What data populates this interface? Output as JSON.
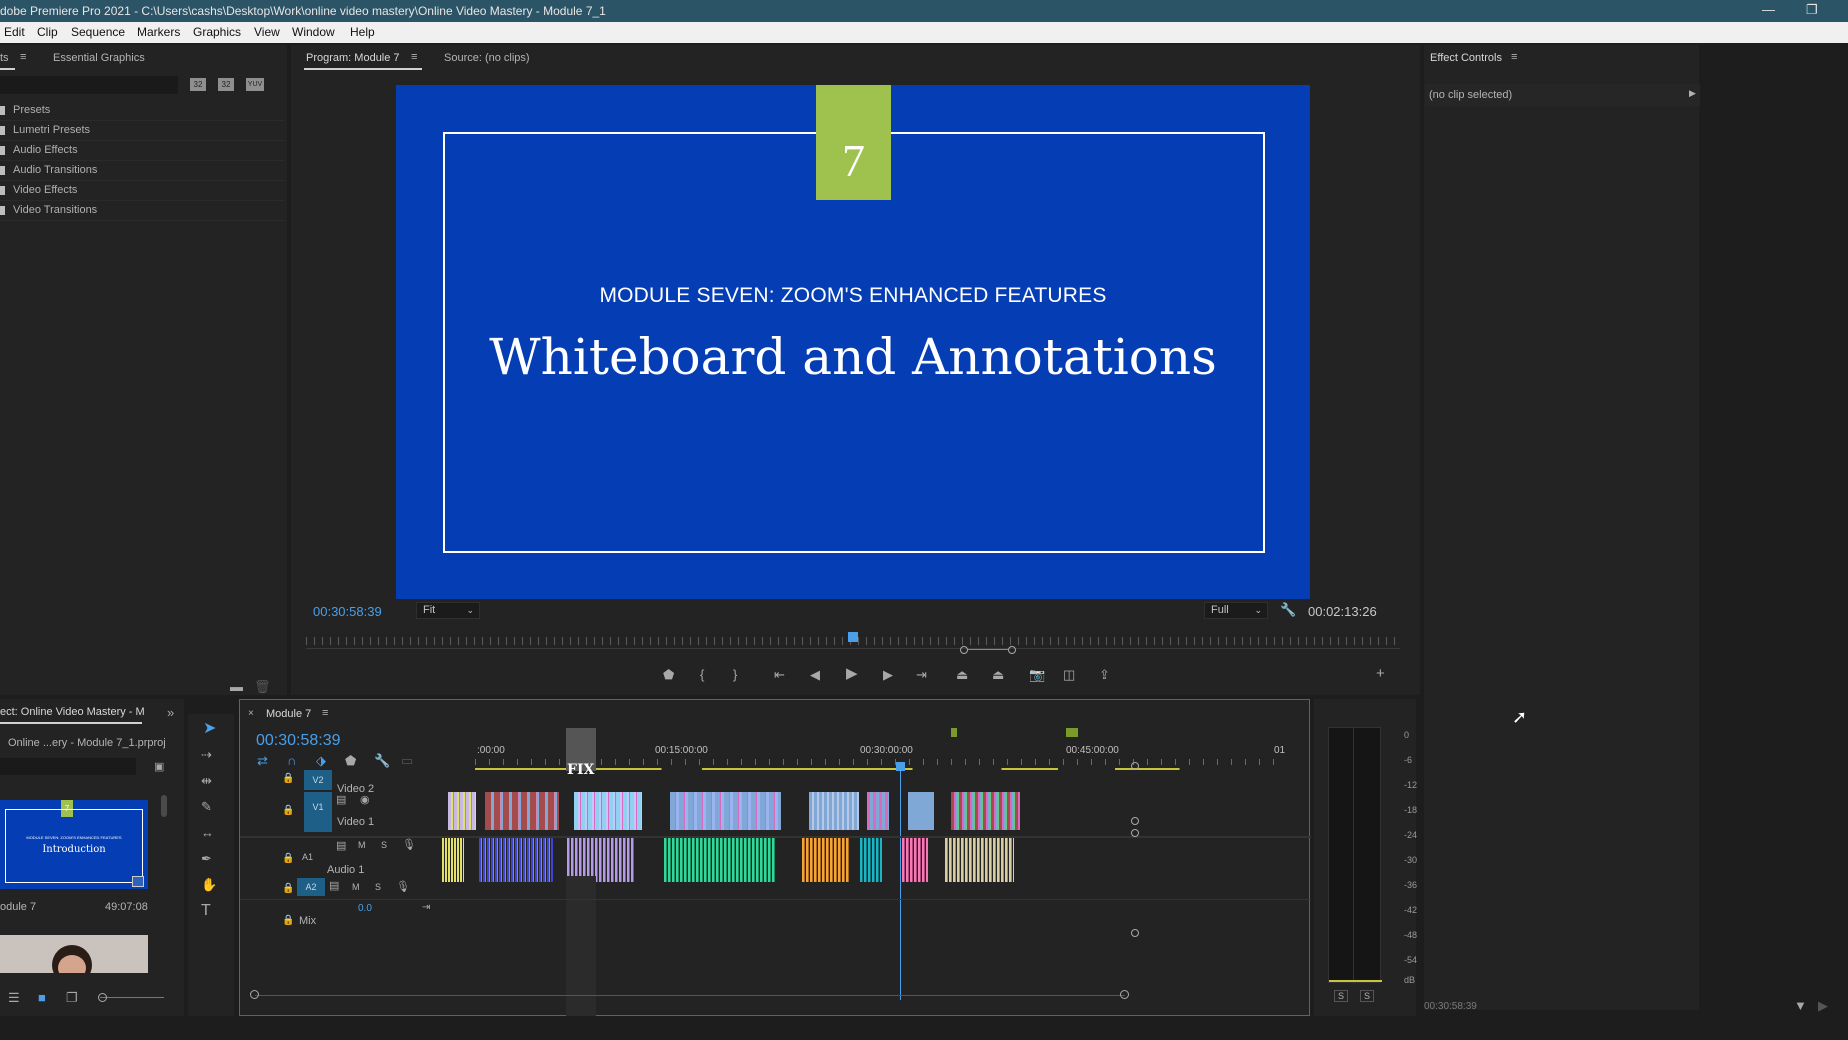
{
  "window": {
    "title": "dobe Premiere Pro 2021 - C:\\Users\\cashs\\Desktop\\Work\\online video mastery\\Online Video Mastery - Module 7_1",
    "minimize": "—",
    "restore": "❐"
  },
  "menu": [
    "Edit",
    "Clip",
    "Sequence",
    "Markers",
    "Graphics",
    "View",
    "Window",
    "Help"
  ],
  "effects_panel": {
    "tab_partial": "ts",
    "tab_essential": "Essential Graphics",
    "folders": [
      "Presets",
      "Lumetri Presets",
      "Audio Effects",
      "Audio Transitions",
      "Video Effects",
      "Video Transitions"
    ],
    "filter_icons": [
      "32",
      "32",
      "YUV"
    ]
  },
  "project_panel": {
    "tab": "ect: Online Video Mastery - M",
    "file": "Online ...ery - Module 7_1.prproj",
    "thumb1": {
      "sub": "MODULE SEVEN: ZOOM'S ENHANCED FEATURES",
      "title": "Introduction",
      "badge": "7"
    },
    "item_name": "odule 7",
    "item_duration": "49:07:08"
  },
  "program_monitor": {
    "tab_program": "Program: Module 7",
    "tab_source": "Source: (no clips)",
    "badge_number": "7",
    "subtitle": "MODULE SEVEN: ZOOM'S ENHANCED FEATURES",
    "title": "Whiteboard and Annotations",
    "timecode": "00:30:58:39",
    "fit": "Fit",
    "resolution": "Full",
    "duration": "00:02:13:26",
    "playhead_fraction": 0.5
  },
  "effect_controls": {
    "tab": "Effect Controls",
    "no_clip": "(no clip selected)",
    "timecode": "00:30:58:39"
  },
  "timeline": {
    "sequence_name": "Module 7",
    "timecode": "00:30:58:39",
    "ruler": [
      ":00:00",
      "00:15:00:00",
      "00:30:00:00",
      "00:45:00:00",
      "01"
    ],
    "fix_label": "FIX",
    "tracks": {
      "v2": {
        "tag": "V2",
        "name": "Video 2"
      },
      "v1": {
        "tag": "V1",
        "name": "Video 1"
      },
      "a1": {
        "tag": "A1",
        "name": "Audio 1"
      },
      "a2": {
        "tag": "A2",
        "volume": "0.0"
      },
      "mix": {
        "name": "Mix"
      }
    },
    "track_buttons": {
      "m": "M",
      "s": "S"
    }
  },
  "audio_meter": {
    "labels": [
      "0",
      "-6",
      "-12",
      "-18",
      "-24",
      "-30",
      "-36",
      "-42",
      "-48",
      "-54",
      "dB"
    ],
    "solo": [
      "S",
      "S"
    ]
  }
}
